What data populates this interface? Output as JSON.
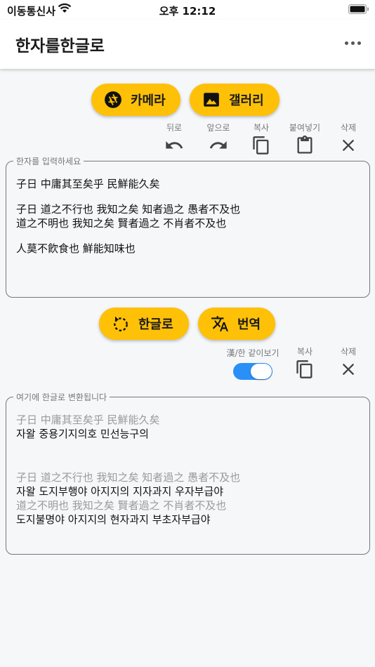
{
  "status_bar": {
    "carrier": "이동통신사",
    "time": "오후 12:12"
  },
  "app_bar": {
    "title": "한자를한글로"
  },
  "top_buttons": {
    "camera": "카메라",
    "gallery": "갤러리"
  },
  "input_toolbar": {
    "undo": "뒤로",
    "redo": "앞으로",
    "copy": "복사",
    "paste": "붙여넣기",
    "delete": "삭제"
  },
  "input_field": {
    "label": "한자를 입력하세요",
    "lines": [
      "子日 中庸其至矣乎 民鮮能久矣",
      "",
      "子日 道之不行也 我知之矣 知者過之 愚者不及也",
      "道之不明也 我知之矣 賢者過之 不肖者不及也",
      "",
      "人莫不飮食也 鮮能知味也"
    ]
  },
  "mid_buttons": {
    "hangul": "한글로",
    "translate": "번역"
  },
  "output_toolbar": {
    "toggle_label": "漢/한 같이보기",
    "toggle_on": true,
    "copy": "복사",
    "delete": "삭제"
  },
  "output_field": {
    "label": "여기에 한글로 변환됩니다",
    "hanja_1": "子日 中庸其至矣乎 民鮮能久矣",
    "hangul_1": "자왈 중용기지의호 민선능구의",
    "hanja_2": "子日 道之不行也 我知之矣 知者過之 愚者不及也",
    "hangul_2": "자왈 도지부행야 아지지의 지자과지 우자부급야",
    "hanja_3": "道之不明也 我知之矣 賢者過之 不肖者不及也",
    "hangul_3": "도지불명야 아지지의 현자과지 부초자부급야"
  },
  "colors": {
    "accent": "#ffc107",
    "toggle": "#2a8ff7",
    "text_muted": "#9a9a9a"
  }
}
